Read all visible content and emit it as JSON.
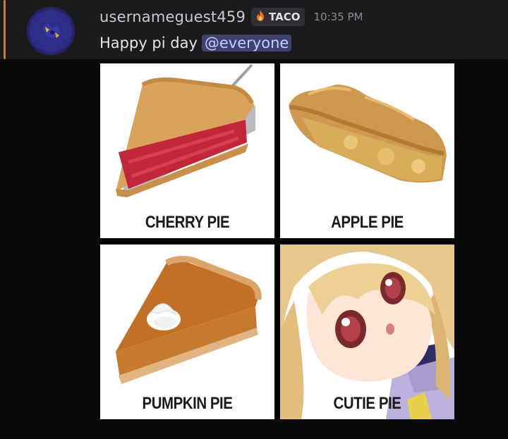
{
  "message": {
    "username": "usernameguest459",
    "tag": {
      "icon": "fire-icon",
      "label": "TACO"
    },
    "timestamp": "10:35 PM",
    "text": "Happy pi day",
    "mention": "@everyone"
  },
  "image": {
    "panels": [
      {
        "caption": "CHERRY PIE",
        "icon": "cherry-pie-illustration"
      },
      {
        "caption": "APPLE PIE",
        "icon": "apple-pie-illustration"
      },
      {
        "caption": "PUMPKIN PIE",
        "icon": "pumpkin-pie-illustration"
      },
      {
        "caption": "CUTIE PIE",
        "icon": "anime-girl-illustration"
      }
    ]
  },
  "colors": {
    "background": "#0a0a0d",
    "highlight": "#1c1a1a",
    "mention_bar": "#b8862e",
    "mention_bg": "#3c4370",
    "mention_text": "#c9cdfb"
  }
}
